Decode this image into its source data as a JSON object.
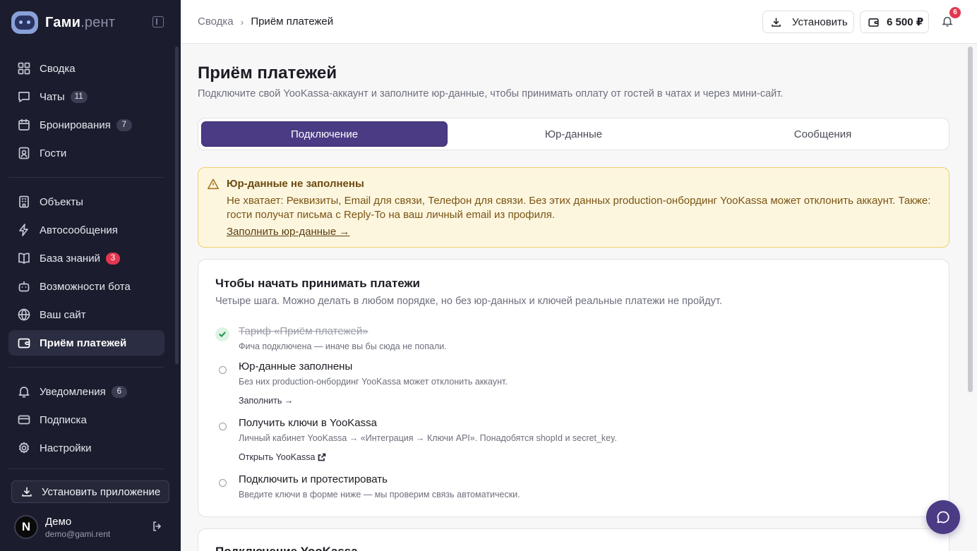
{
  "brand": {
    "name": "Гами",
    "suffix": ".рент"
  },
  "sidebar": {
    "groups": [
      [
        {
          "label": "Сводка",
          "icon": "dashboard-icon",
          "badge": null
        },
        {
          "label": "Чаты",
          "icon": "chat-icon",
          "badge": "11"
        },
        {
          "label": "Бронирования",
          "icon": "calendar-icon",
          "badge": "7"
        },
        {
          "label": "Гости",
          "icon": "guest-card-icon",
          "badge": null
        }
      ],
      [
        {
          "label": "Объекты",
          "icon": "building-icon",
          "badge": null
        },
        {
          "label": "Автосообщения",
          "icon": "lightning-icon",
          "badge": null
        },
        {
          "label": "База знаний",
          "icon": "book-icon",
          "badge": "3",
          "badge_color": "#e5364f"
        },
        {
          "label": "Возможности бота",
          "icon": "bot-icon",
          "badge": null
        },
        {
          "label": "Ваш сайт",
          "icon": "globe-icon",
          "badge": null
        },
        {
          "label": "Приём платежей",
          "icon": "wallet-icon",
          "badge": null,
          "active": true
        }
      ],
      [
        {
          "label": "Уведомления",
          "icon": "bell-icon",
          "badge": "6"
        },
        {
          "label": "Подписка",
          "icon": "card-icon",
          "badge": null
        },
        {
          "label": "Настройки",
          "icon": "gear-icon",
          "badge": null
        }
      ]
    ],
    "install_label": "Установить приложение",
    "user": {
      "initial": "N",
      "name": "Демо",
      "email": "demo@gami.rent"
    }
  },
  "topbar": {
    "breadcrumb": [
      "Сводка",
      "Приём платежей"
    ],
    "install_label": "Установить",
    "balance": "6 500 ₽",
    "notifications_count": "6"
  },
  "page": {
    "title": "Приём платежей",
    "subtitle": "Подключите свой YooKassa-аккаунт и заполните юр-данные, чтобы принимать оплату от гостей в чатах и через мини-сайт."
  },
  "tabs": [
    {
      "label": "Подключение",
      "active": true
    },
    {
      "label": "Юр-данные",
      "active": false
    },
    {
      "label": "Сообщения",
      "active": false
    }
  ],
  "alert": {
    "title": "Юр-данные не заполнены",
    "body": "Не хватает: Реквизиты, Email для связи, Телефон для связи. Без этих данных production-онбординг YooKassa может отклонить аккаунт. Также: гости получат письма с Reply-To на ваш личный email из профиля.",
    "link": "Заполнить юр-данные →"
  },
  "steps_card": {
    "title": "Чтобы начать принимать платежи",
    "subtitle": "Четыре шага. Можно делать в любом порядке, но без юр-данных и ключей реальные платежи не пройдут.",
    "steps": [
      {
        "title": "Тариф «Приём платежей»",
        "desc": "Фича подключена — иначе вы бы сюда не попали.",
        "done": true,
        "link": null
      },
      {
        "title": "Юр-данные заполнены",
        "desc": "Без них production-онбординг YooKassa может отклонить аккаунт.",
        "done": false,
        "link": "Заполнить →"
      },
      {
        "title": "Получить ключи в YooKassa",
        "desc": "Личный кабинет YooKassa → «Интеграция → Ключи API». Понадобятся shopId и secret_key.",
        "done": false,
        "link": "Открыть YooKassa"
      },
      {
        "title": "Подключить и протестировать",
        "desc": "Введите ключи в форме ниже — мы проверим связь автоматически.",
        "done": false,
        "link": null
      }
    ]
  },
  "next_card": {
    "title": "Подключение YooKassa"
  },
  "colors": {
    "accent": "#4b3b85",
    "sidebar_bg": "#1b1d2e",
    "warning_bg": "#fdf6df",
    "badge_red": "#e5364f"
  }
}
